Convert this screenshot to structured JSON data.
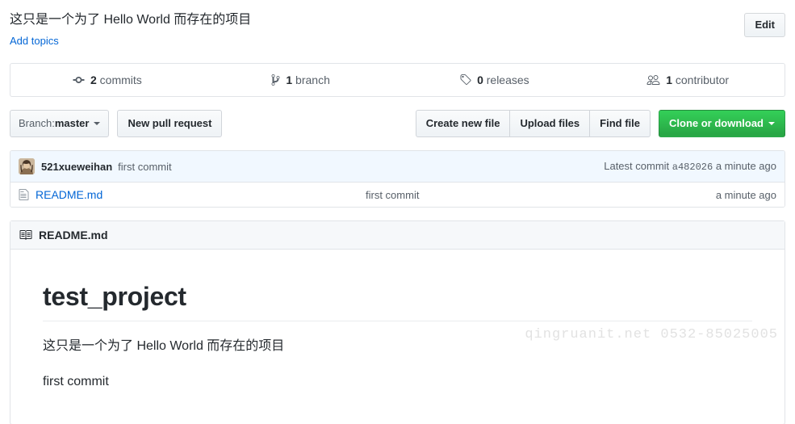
{
  "repo": {
    "description": "这只是一个为了 Hello World 而存在的项目",
    "add_topics_label": "Add topics",
    "edit_button_label": "Edit"
  },
  "numbers_summary": [
    {
      "icon": "commit-icon",
      "count": "2",
      "label": " commits",
      "name": "commits"
    },
    {
      "icon": "branch-icon",
      "count": "1",
      "label": " branch",
      "name": "branches"
    },
    {
      "icon": "tag-icon",
      "count": "0",
      "label": " releases",
      "name": "releases"
    },
    {
      "icon": "people-icon",
      "count": "1",
      "label": " contributor",
      "name": "contributors"
    }
  ],
  "file_nav": {
    "branch_prefix": "Branch: ",
    "branch_name": "master",
    "new_pull_request_label": "New pull request",
    "create_new_file_label": "Create new file",
    "upload_files_label": "Upload files",
    "find_file_label": "Find file",
    "clone_or_download_label": "Clone or download"
  },
  "commit_tease": {
    "author": "521xueweihan",
    "message": "first commit",
    "latest_commit_label": "Latest commit",
    "sha": "a482026",
    "age": "a minute ago"
  },
  "files": [
    {
      "icon": "file-icon",
      "name": "README.md",
      "message": "first commit",
      "age": "a minute ago"
    }
  ],
  "readme": {
    "header_title": "README.md",
    "heading": "test_project",
    "paragraphs": [
      "这只是一个为了 Hello World 而存在的项目",
      "first commit"
    ]
  },
  "watermark": {
    "text": "qingruanit.net 0532-85025005"
  },
  "colors": {
    "link": "#0366d6",
    "text": "#24292e",
    "muted": "#586069",
    "border": "#e1e4e8",
    "commit_tease_bg": "#f1f8ff",
    "readme_head_bg": "#f6f8fa",
    "green_button": "#28a745",
    "watermark": "#e2e2e2"
  }
}
